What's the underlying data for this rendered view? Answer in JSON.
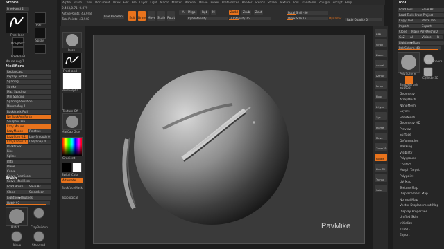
{
  "menu": [
    "Alpha",
    "Brush",
    "Color",
    "Document",
    "Draw",
    "Edit",
    "File",
    "Layer",
    "Light",
    "Macro",
    "Marker",
    "Material",
    "Movie",
    "Picker",
    "Preferences",
    "Render",
    "Stencil",
    "Stroke",
    "Texture",
    "Tool",
    "Transform",
    "Zplugin",
    "Zscript",
    "Help"
  ],
  "stats": {
    "active_points": "ActivePoints: 43,948",
    "total_points": "TotalPoints: 43,948",
    "coords": "0.403,0.71,-0.879"
  },
  "top": {
    "live_boolean": "Live Boolean",
    "edit": "Edit",
    "draw": "Draw",
    "move": "Move",
    "scale": "Scale",
    "rotate": "Rotate",
    "a": "A",
    "mrgb": "Mrgb",
    "rgb": "Rgb",
    "m": "M",
    "zadd": "Zadd",
    "zsub": "Zsub",
    "zcut": "Zcut",
    "rgb_intensity": "Rgb Intensity",
    "z_intensity": "Z Intensity 25",
    "focal_shift": "Focal Shift -56",
    "draw_size": "Draw Size 15",
    "dynamic": "Dynamic",
    "fade_opacity": "Fade Opacity 0"
  },
  "stroke": {
    "title": "Stroke",
    "freehand": "FreeHand 2",
    "labels": [
      "FreeHand",
      "Dots",
      "DragRect",
      "Spray",
      "FreeHand",
      "Color Spray"
    ],
    "mouse_avg": "Mouse Avg 1"
  },
  "modifiers": {
    "title": "Modifiers",
    "items": [
      "ReplayLast",
      "ReplayLastRel",
      "Spacing",
      "Stroke",
      "Max Spacing",
      "Min Spacing",
      "Spacing Variation",
      "Mouse Avg 1",
      "Backtrack Roll",
      "No BackAndForth",
      "Sculptris Pro",
      "Lazy Mouse",
      "LazyMouse",
      "Relative",
      "LazyStep 0.1",
      "LazySmooth 0",
      "LazyRadius 1",
      "LazySnap 0",
      "Backtrack",
      "Line",
      "Spline",
      "Path",
      "Plane",
      "Curve",
      "Curve Functions",
      "Curve Modifiers",
      "Inventory"
    ]
  },
  "brush": {
    "title": "Brush",
    "load": "Load Brush",
    "save_as": "Save As",
    "clone": "Clone",
    "select_icon": "SelectIcon",
    "lightbox": "Lightbox▸Brushes",
    "hatch": "Hatch 97",
    "names": [
      "Hatch",
      "ClayBuildup",
      "Move",
      "Standard"
    ]
  },
  "mid": {
    "hatch": "Hatch",
    "freehand": "FreeHand",
    "brush_alpha": "BrushAlpha",
    "texture": "Texture Off",
    "matcap": "MatCap Gray",
    "gradient": "Gradient",
    "switch_color": "SwitchColor",
    "alternate": "Alternate",
    "backface": "BackfaceMask",
    "topological": "Topological"
  },
  "right_tools": [
    "BPR",
    "Scroll",
    "Zoom",
    "Actual",
    "AAHalf",
    "Persp",
    "Floor",
    "L.Sym",
    "Xyz",
    "Frame",
    "Move",
    "Zoom3D",
    "Rotate",
    "Line Fill",
    "Transp",
    "Solo"
  ],
  "tool": {
    "title": "Tool",
    "buttons": [
      "Load Tool",
      "Save As",
      "Load Tools From Project",
      "Copy Tool",
      "Paste Tool",
      "Import",
      "Export",
      "Clone",
      "Make PolyMesh3D",
      "GoZ",
      "All",
      "Visible",
      "R",
      "Lightbox▸Tools",
      "PolySphere. 48"
    ],
    "thumbs": [
      "PolySphere",
      "PolySphere",
      "Cylinder3D",
      "SimpleBrush"
    ],
    "list": [
      "Subtool",
      "Geometry",
      "ArrayMesh",
      "NanoMesh",
      "Layers",
      "FiberMesh",
      "Geometry HD",
      "Preview",
      "Surface",
      "Deformation",
      "Masking",
      "Visibility",
      "Polygroups",
      "Contact",
      "Morph Target",
      "Polypaint",
      "UV Map",
      "Texture Map",
      "Displacement Map",
      "Normal Map",
      "Vector Displacement Map",
      "Display Properties",
      "Unified Skin",
      "Initialize",
      "Import",
      "Export"
    ]
  },
  "watermark": "PavMike",
  "colors": {
    "accent": "#e8731c",
    "bg": "#1d1d1d",
    "panel": "#262626"
  }
}
